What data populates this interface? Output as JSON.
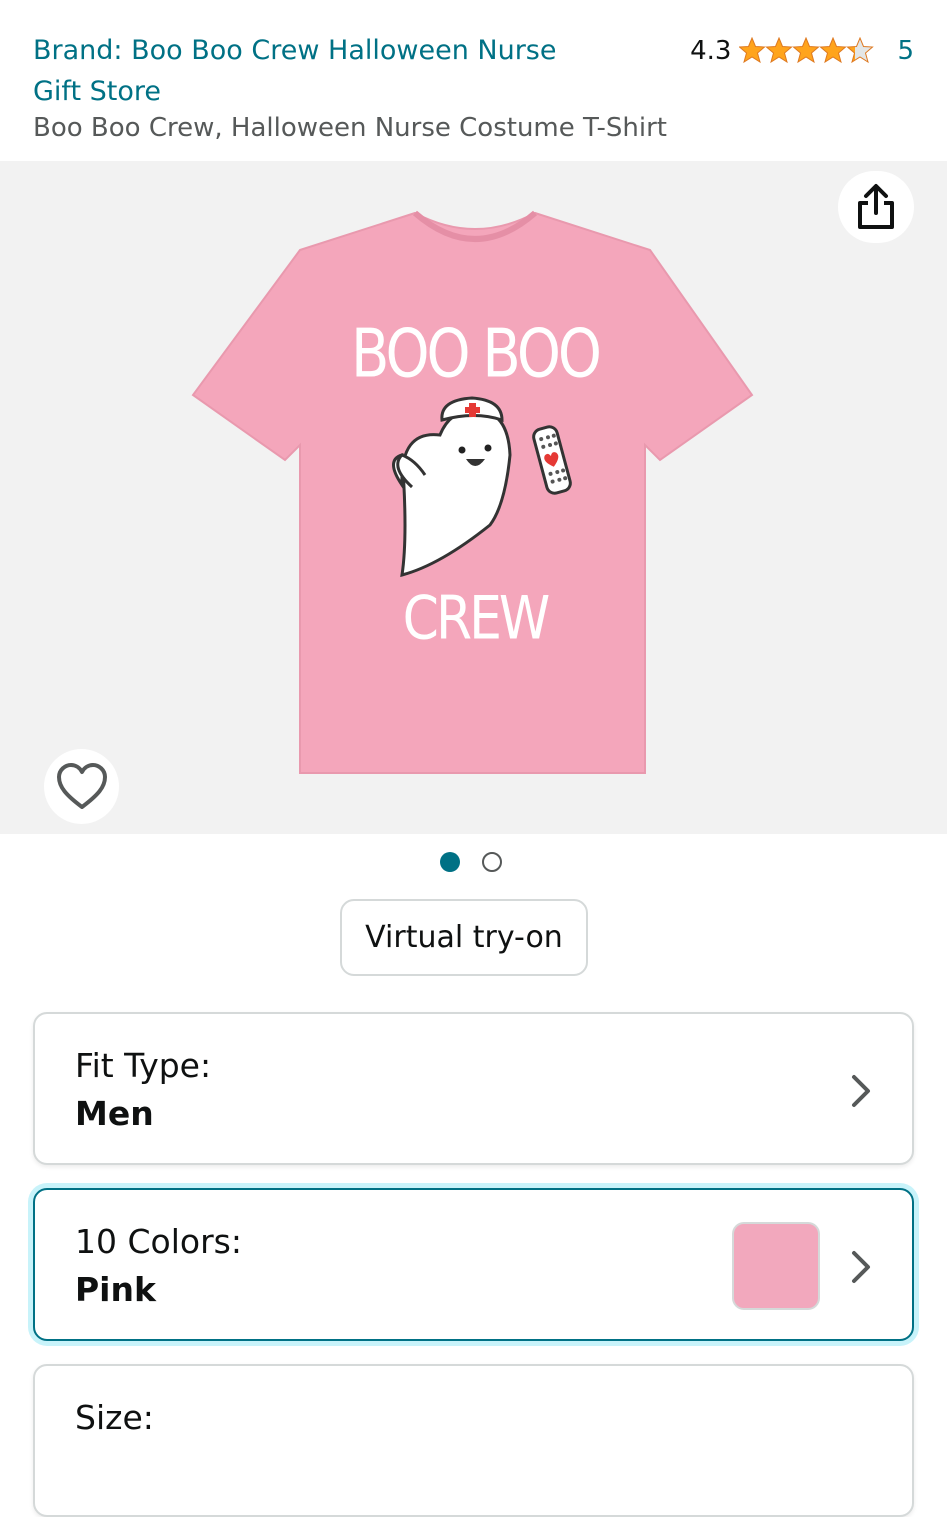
{
  "header": {
    "brand_link": "Brand: Boo Boo Crew Halloween Nurse Gift Store",
    "rating_value": "4.3",
    "rating_stars": 4.3,
    "rating_count": "5",
    "product_title": "Boo Boo Crew, Halloween Nurse Costume T-Shirt"
  },
  "gallery": {
    "shirt_text_top": "BOO BOO",
    "shirt_text_bottom": "CREW",
    "shirt_color": "#f4a6bb",
    "share_icon": "share-icon",
    "wishlist_icon": "heart-icon",
    "image_count": 2,
    "active_image": 1
  },
  "tryon_button": "Virtual try-on",
  "options": {
    "fit_type": {
      "label": "Fit Type:",
      "value": "Men"
    },
    "colors": {
      "label": "10 Colors:",
      "value": "Pink",
      "swatch_color": "#f2a8bd"
    },
    "size": {
      "label": "Size:"
    }
  },
  "colors": {
    "link": "#007185",
    "star": "#ffa41c",
    "selected_border": "#007185"
  }
}
